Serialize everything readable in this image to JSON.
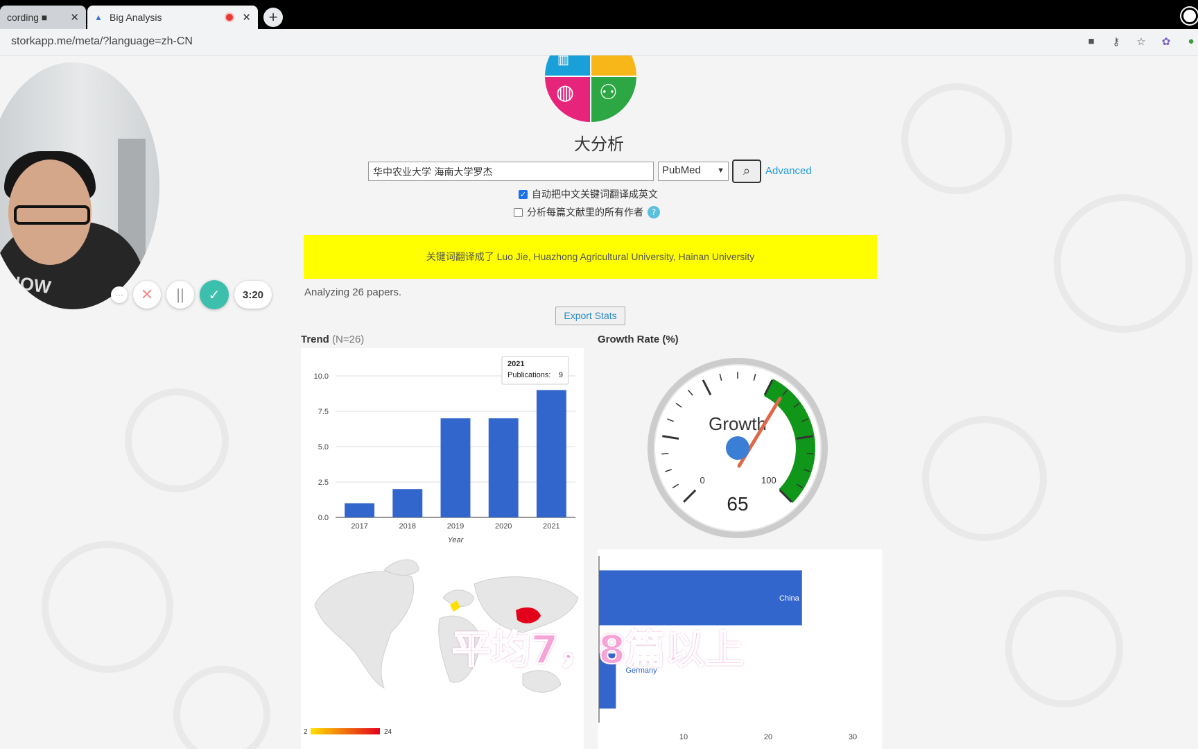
{
  "browser": {
    "tabs": [
      {
        "label": "cording ■",
        "close": "✕"
      },
      {
        "label": "Big Analysis",
        "close": "✕"
      }
    ],
    "new_tab": "+",
    "url": "storkapp.me/meta/?language=zh-CN"
  },
  "page": {
    "site_title": "大分析",
    "search": {
      "value": "华中农业大学 海南大学罗杰",
      "database": "PubMed",
      "advanced_label": "Advanced"
    },
    "options": [
      {
        "label": "自动把中文关键词翻译成英文",
        "checked": true
      },
      {
        "label": "分析每篇文献里的所有作者",
        "checked": false
      }
    ],
    "help_icon": "?",
    "notice": "关键词翻译成了 Luo Jie, Huazhong Agricultural University, Hainan University",
    "analyzing": "Analyzing 26 papers.",
    "export_label": "Export Stats",
    "trend_title": "Trend",
    "trend_n": "(N=26)",
    "growth_title": "Growth Rate (%)"
  },
  "chart_data": [
    {
      "type": "bar",
      "xlabel": "Year",
      "categories": [
        "2017",
        "2018",
        "2019",
        "2020",
        "2021"
      ],
      "values": [
        1,
        2,
        7,
        7,
        9
      ],
      "ylim": [
        0,
        10
      ],
      "yticks": [
        "10.0",
        "7.5",
        "5.0",
        "2.5",
        "0.0"
      ],
      "bar_color": "#3366cc",
      "tooltip": {
        "title": "2021",
        "label": "Publications:",
        "value": "9"
      }
    },
    {
      "type": "gauge",
      "label": "Growth",
      "value": 65,
      "min_label": "0",
      "max_label": "100",
      "green_range": [
        60,
        100
      ]
    },
    {
      "type": "bar",
      "orientation": "horizontal",
      "categories": [
        "China",
        "Germany"
      ],
      "values": [
        24,
        2
      ],
      "xlim": [
        0,
        30
      ],
      "xticks": [
        "10",
        "20",
        "30"
      ],
      "bar_color": "#3366cc"
    },
    {
      "type": "heatmap",
      "legend_min": "2",
      "legend_max": "24"
    }
  ],
  "recorder": {
    "more": "···",
    "cancel": "✕",
    "pause": "||",
    "done": "✓",
    "timer": "3:20"
  },
  "subtitle": "平均7，8篇以上"
}
